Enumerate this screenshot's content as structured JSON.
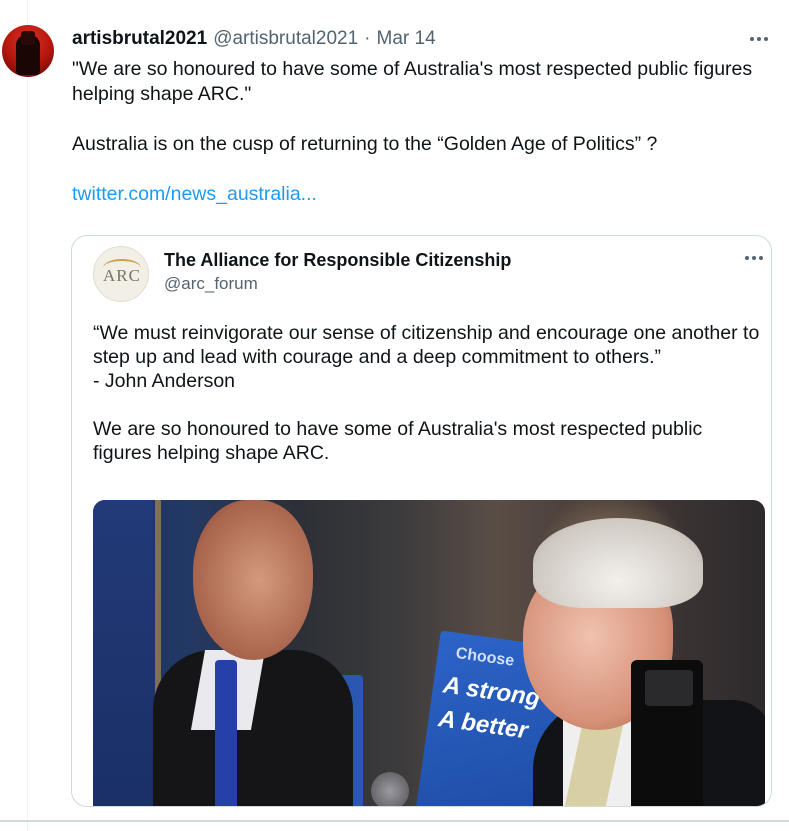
{
  "tweet": {
    "author_name": "artisbrutal2021",
    "handle": "@artisbrutal2021",
    "separator": "·",
    "date": "Mar 14",
    "text_line_1": "\"We are so honoured to have some of Australia's most respected public figures helping shape ARC.\"",
    "text_line_2": "Australia is on the cusp of returning to the “Golden Age of Politics” ?",
    "link": "twitter.com/news_australia..."
  },
  "quoted_tweet": {
    "logo_text": "ARC",
    "author_name": "The Alliance for Responsible Citizenship",
    "handle": "@arc_forum",
    "quote_text": "“We must reinvigorate our sense of citizenship and encourage one another to step up and lead with courage and a deep commitment to others.”",
    "attribution": "- John Anderson",
    "body_text": "We are so honoured to have some of Australia's most respected public figures helping shape ARC.",
    "sign_text_1": "Choose",
    "sign_text_2": "A strong",
    "sign_text_3": "A better"
  },
  "icons": {
    "more": "more-horizontal-icon"
  },
  "colors": {
    "link": "#1d9bf0",
    "secondary_text": "#536471",
    "border": "#cfd9de"
  }
}
